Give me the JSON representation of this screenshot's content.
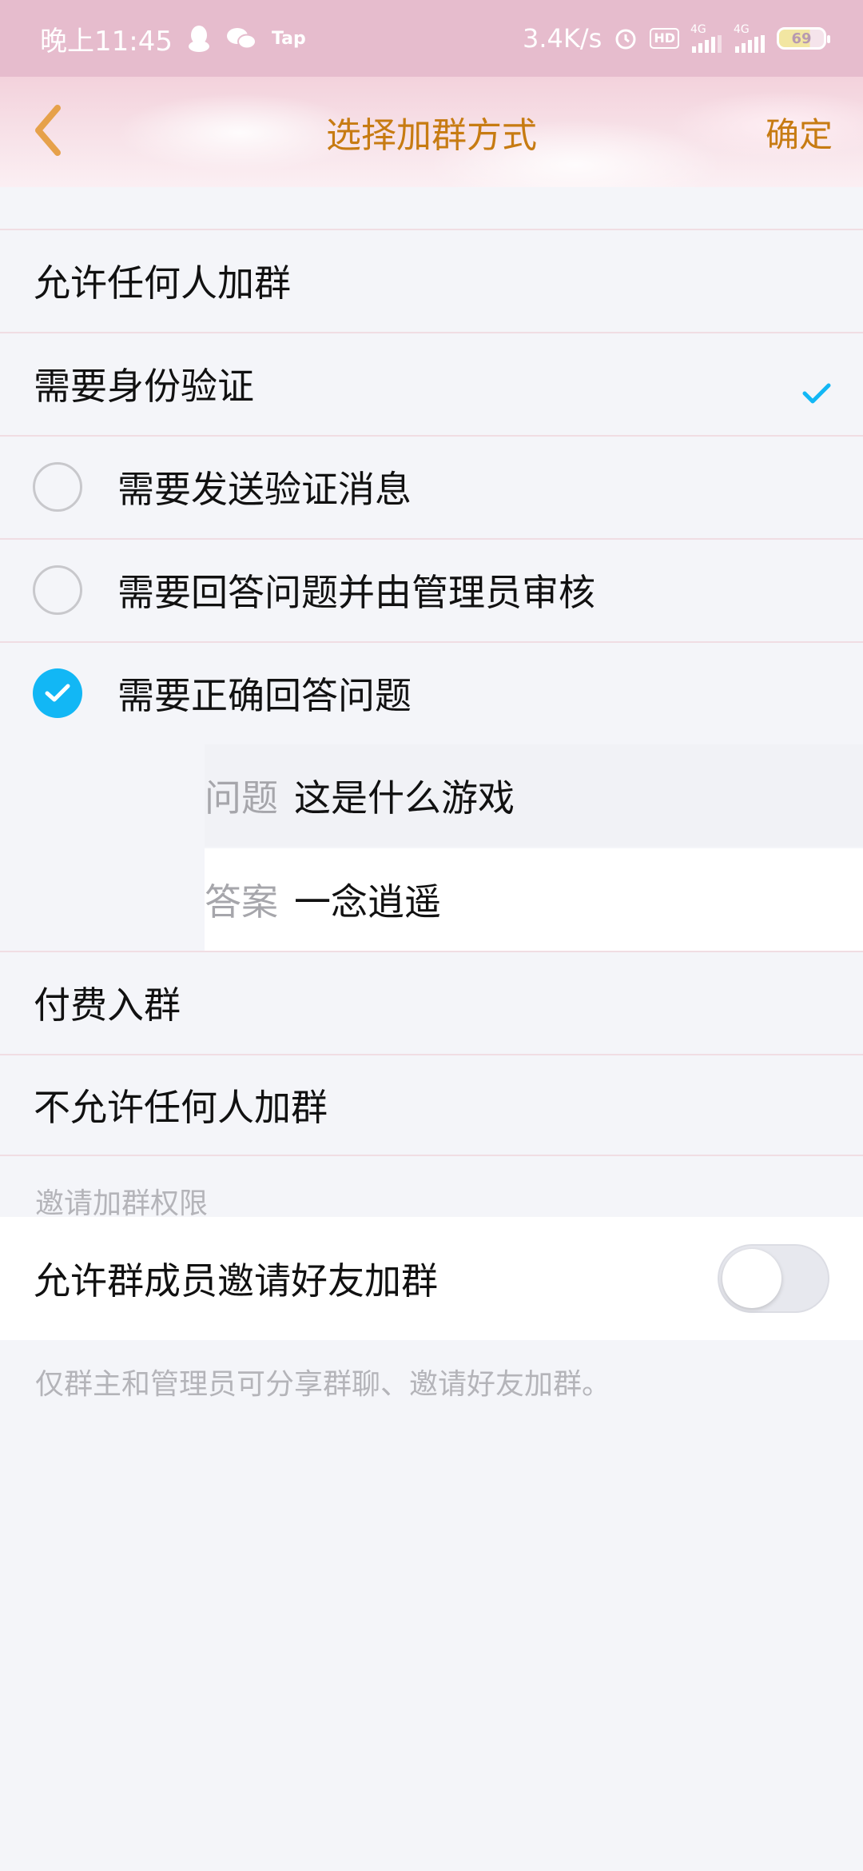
{
  "status_bar": {
    "time": "晚上11:45",
    "tap_label": "Tap",
    "net_speed": "3.4K/s",
    "hd_label": "HD",
    "signal1_label": "4G",
    "signal2_label": "4G",
    "battery_level": "69"
  },
  "header": {
    "title": "选择加群方式",
    "confirm_label": "确定",
    "accent_color": "#c77b12"
  },
  "options": {
    "allow_anyone": "允许任何人加群",
    "require_verification": "需要身份验证",
    "sub": {
      "send_message": "需要发送验证消息",
      "answer_admin_review": "需要回答问题并由管理员审核",
      "answer_correctly": "需要正确回答问题"
    },
    "qa": {
      "question_key": "问题",
      "question_value": "这是什么游戏",
      "answer_key": "答案",
      "answer_value": "一念逍遥"
    },
    "paid_join": "付费入群",
    "disallow_anyone": "不允许任何人加群"
  },
  "invite": {
    "section_label": "邀请加群权限",
    "toggle_label": "允许群成员邀请好友加群",
    "toggle_on": false,
    "footnote": "仅群主和管理员可分享群聊、邀请好友加群。"
  },
  "colors": {
    "check_blue": "#12b7f5",
    "status_bar_bg": "#e6bccd"
  }
}
